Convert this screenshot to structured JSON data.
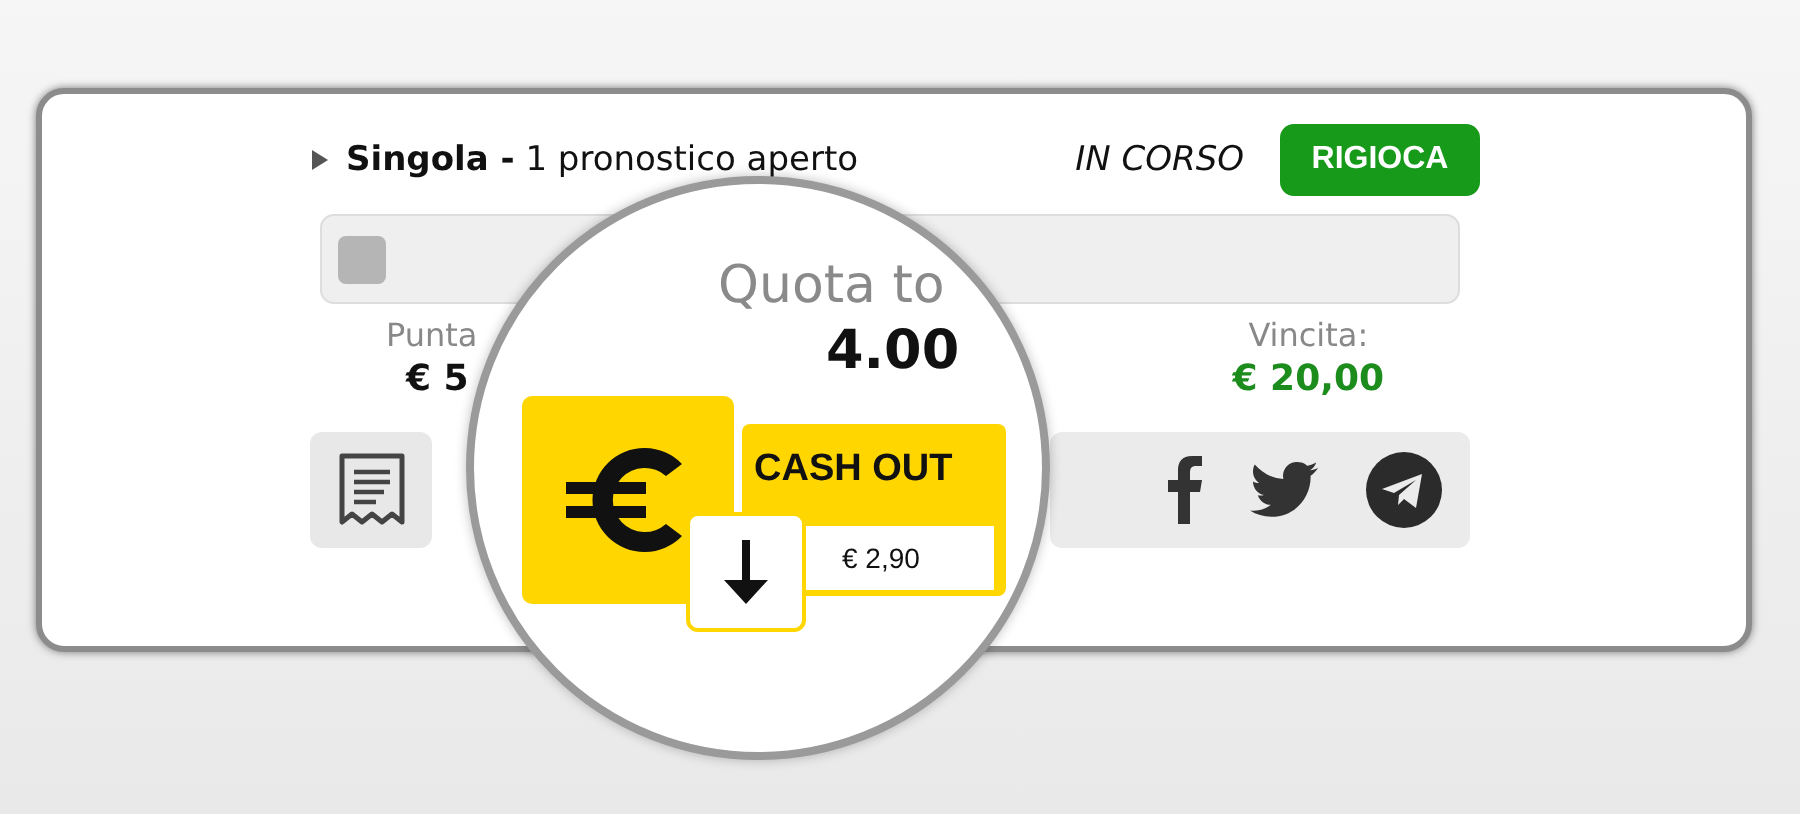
{
  "bet": {
    "title": "**Singola -** 1 pronostico aperto",
    "expanded": false,
    "status": "IN CORSO",
    "replay_button": "RIGIOCA"
  },
  "summary": {
    "stake_label": "Punta",
    "stake_value": "€ 5",
    "win_label": "Vincita:",
    "win_value": "€ 20,00"
  },
  "magnifier": {
    "odds_label": "Quota to",
    "odds_value": "4.00",
    "cash_out": {
      "label": "CASH OUT",
      "amount": "€ 2,90"
    }
  }
}
